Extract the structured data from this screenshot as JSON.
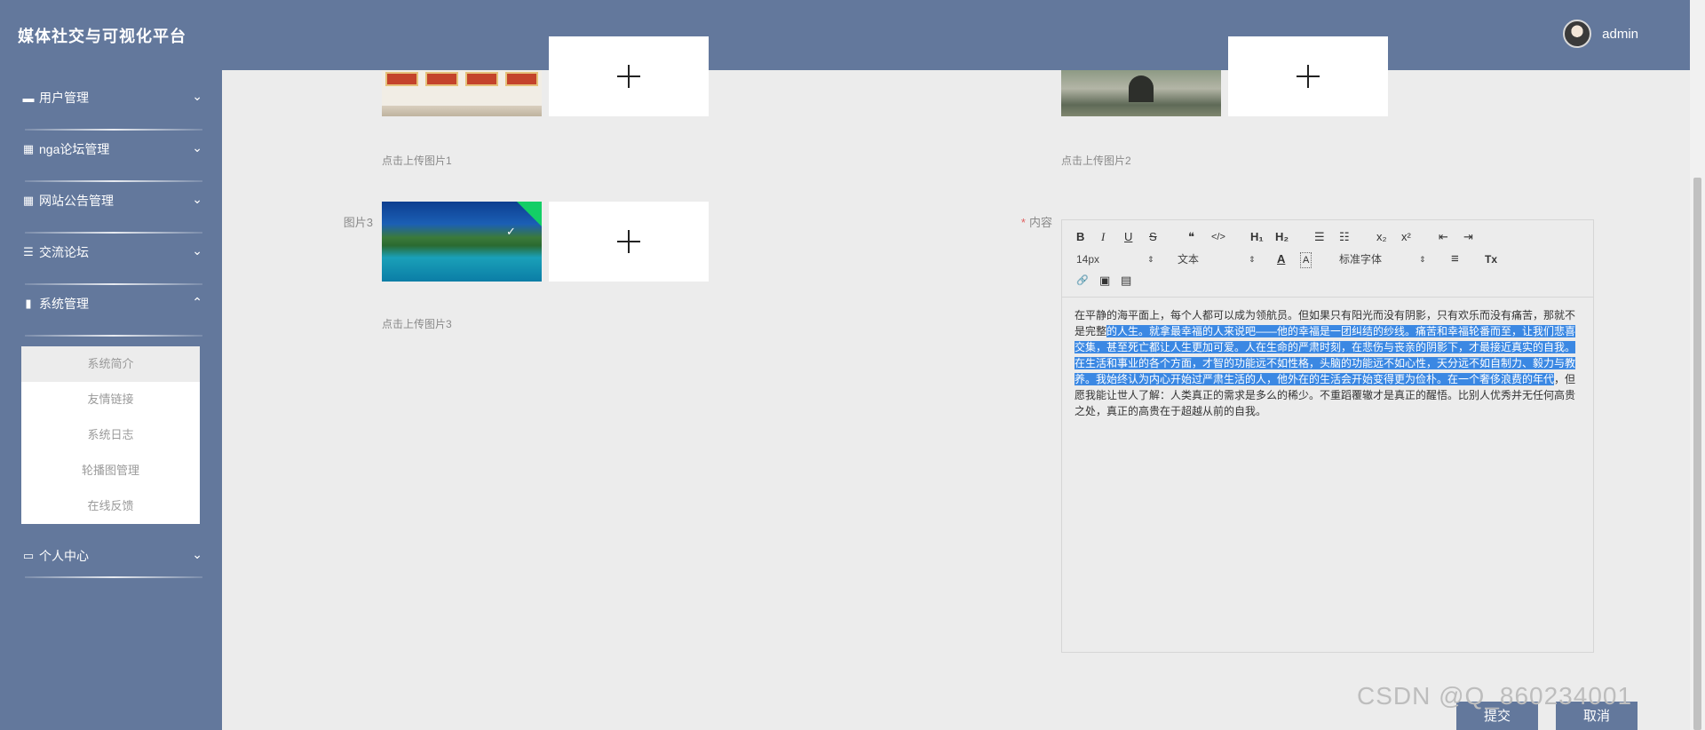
{
  "header": {
    "title": "媒体社交与可视化平台",
    "username": "admin"
  },
  "sidebar": {
    "items": [
      {
        "label": "用户管理",
        "icon": "monitor-icon"
      },
      {
        "label": "nga论坛管理",
        "icon": "grid-icon"
      },
      {
        "label": "网站公告管理",
        "icon": "table-icon"
      },
      {
        "label": "交流论坛",
        "icon": "sliders-icon"
      },
      {
        "label": "系统管理",
        "icon": "bar-chart-icon"
      },
      {
        "label": "个人中心",
        "icon": "id-card-icon"
      }
    ],
    "submenu": [
      "系统简介",
      "友情链接",
      "系统日志",
      "轮播图管理",
      "在线反馈"
    ],
    "active_submenu": "系统简介"
  },
  "form": {
    "upload1_hint": "点击上传图片1",
    "upload2_hint": "点击上传图片2",
    "upload3_label": "图片3",
    "upload3_hint": "点击上传图片3",
    "content_label": "内容",
    "required_mark": "*"
  },
  "editor": {
    "toolbar": {
      "bold": "B",
      "italic": "I",
      "underline": "U",
      "strike": "S",
      "quote": "❝",
      "code": "</>",
      "h1": "H₁",
      "h2": "H₂",
      "ordered_list": "☰",
      "bullet_list": "☷",
      "subscript": "x₂",
      "superscript": "x²",
      "outdent": "⇤",
      "indent": "⇥",
      "font_size": "14px",
      "header_select": "文本",
      "font_family": "标准字体",
      "color": "A",
      "background": "A",
      "align": "≡",
      "clear": "Tx",
      "link": "🔗",
      "image": "▣",
      "video": "▤"
    },
    "content": {
      "before": "在平静的海平面上，每个人都可以成为领航员。但如果只有阳光而没有阴影，只有欢乐而没有痛苦，那就不是完整",
      "selected": "的人生。就拿最幸福的人来说吧——他的幸福是一团纠结的纱线。痛苦和幸福轮番而至，让我们悲喜交集，甚至死亡都让人生更加可爱。人在生命的严肃时刻，在悲伤与丧亲的阴影下，才最接近真实的自我。在生活和事业的各个方面，才智的功能远不如性格，头脑的功能远不如心性，天分远不如自制力、毅力与教养。我始终认为内心开始过严肃生活的人，他外在的生活会开始变得更为俭朴。在一个奢侈浪费的年代",
      "after": "，但愿我能让世人了解：人类真正的需求是多么的稀少。不重蹈覆辙才是真正的醒悟。比别人优秀并无任何高贵之处，真正的高贵在于超越从前的自我。"
    }
  },
  "buttons": {
    "submit": "提交",
    "cancel": "取消"
  },
  "watermark": "CSDN @Q_860234001",
  "colors": {
    "primary": "#63789c",
    "selection": "#3b88e3",
    "success": "#13ce66"
  }
}
